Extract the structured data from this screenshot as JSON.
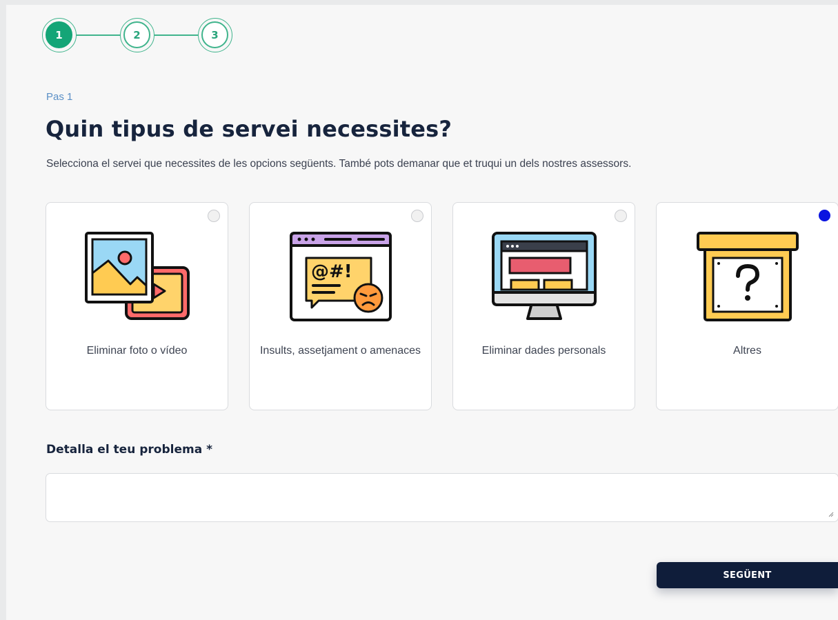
{
  "stepper": {
    "steps": [
      {
        "label": "1",
        "active": true
      },
      {
        "label": "2",
        "active": false
      },
      {
        "label": "3",
        "active": false
      }
    ],
    "accent_color": "#14a577"
  },
  "step_caption": "Pas 1",
  "title": "Quin tipus de servei necessites?",
  "subtitle": "Selecciona el servei que necessites de les opcions següents. També pots demanar que et truqui un dels nostres assessors.",
  "options": [
    {
      "label": "Eliminar foto o vídeo",
      "icon": "photo-video-icon",
      "selected": false
    },
    {
      "label": "Insults, assetjament o amenaces",
      "icon": "angry-chat-icon",
      "selected": false
    },
    {
      "label": "Eliminar dades personals",
      "icon": "monitor-icon",
      "selected": false
    },
    {
      "label": "Altres",
      "icon": "question-box-icon",
      "selected": true
    }
  ],
  "detail": {
    "label": "Detalla el teu problema *",
    "value": ""
  },
  "next_button": {
    "label": "SEGÜENT",
    "color": "#0f1d3a"
  },
  "selected_radio_color": "#0a14e0"
}
